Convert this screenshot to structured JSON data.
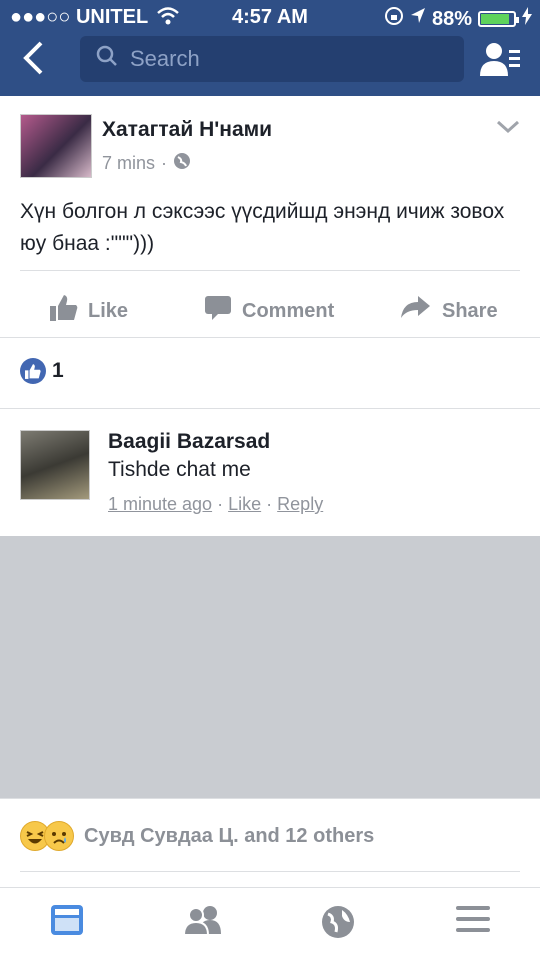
{
  "status": {
    "carrier": "●●●○○ UNITEL",
    "time": "4:57 AM",
    "battery": "88%",
    "battery_level": 0.88
  },
  "nav": {
    "search_placeholder": "Search"
  },
  "post": {
    "author": "Хатагтай Н'нами",
    "time": "7 mins",
    "separator": "·",
    "text": "Хүн болгон л сэксээс үүсдийшд энэнд ичиж зовох юу бнаа :\"\"\")))",
    "actions": {
      "like": "Like",
      "comment": "Comment",
      "share": "Share"
    },
    "like_count": "1"
  },
  "comment": {
    "author": "Baagii Bazarsad",
    "text": "Tishde chat me",
    "time": "1 minute ago",
    "like": "Like",
    "reply": "Reply",
    "sep": "·"
  },
  "social": {
    "text": "Сувд Сувдаа Ц. and 12 others"
  },
  "colors": {
    "brand": "#2f4f86",
    "accent": "#4267b2",
    "muted": "#90949c"
  }
}
